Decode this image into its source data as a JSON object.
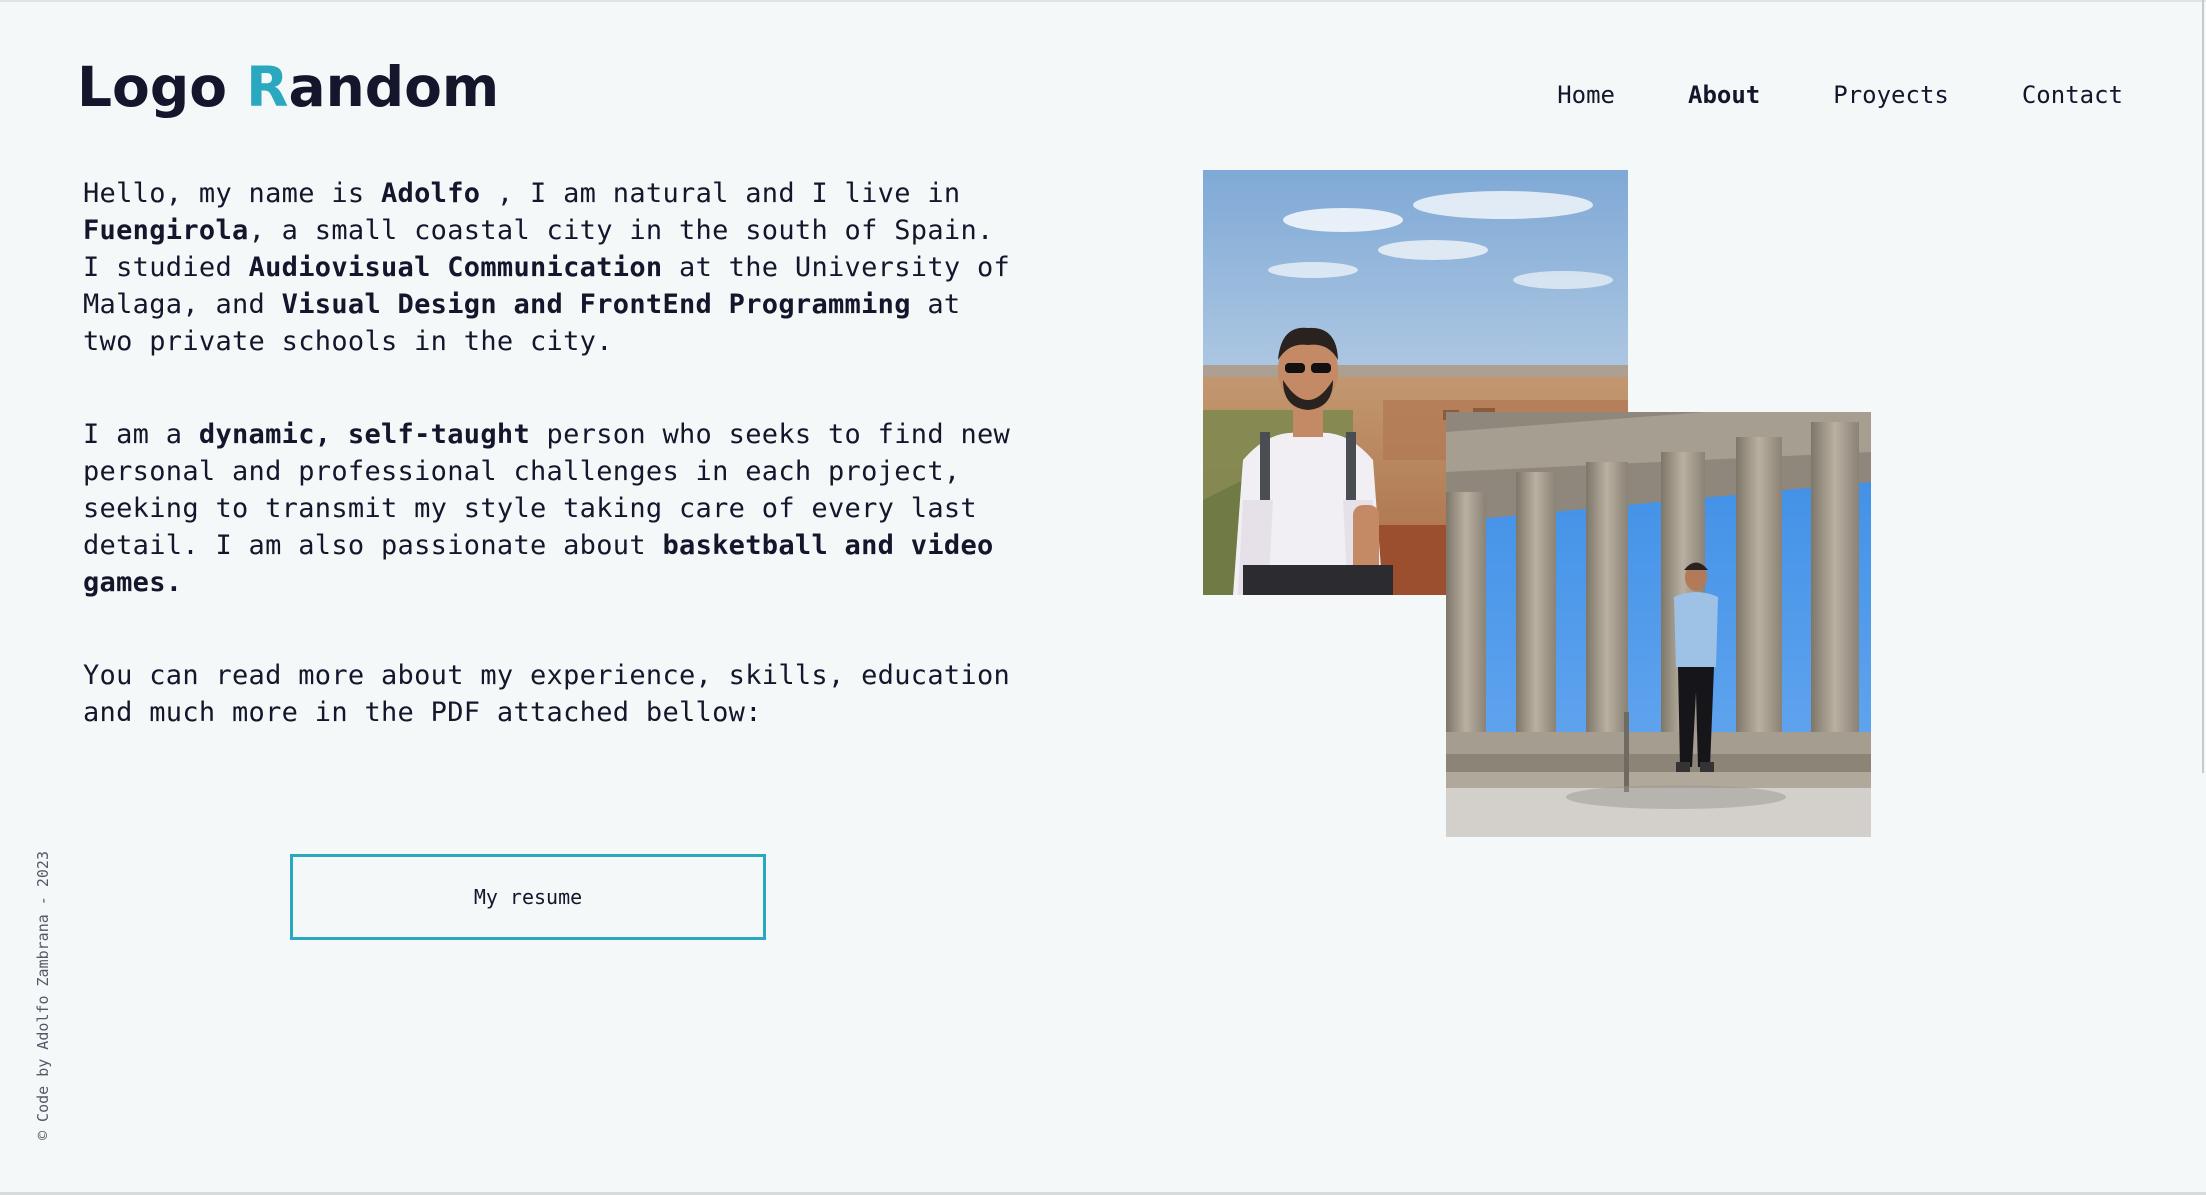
{
  "brand": {
    "logo_prefix": "Logo ",
    "logo_accent": "R",
    "logo_suffix": "andom",
    "accent_color": "#2aa8c0",
    "text_color": "#15152c",
    "background_color": "#f4f8f8"
  },
  "nav": {
    "items": [
      {
        "label": "Home",
        "active": false
      },
      {
        "label": "About",
        "active": true
      },
      {
        "label": "Proyects",
        "active": false
      },
      {
        "label": "Contact",
        "active": false
      }
    ]
  },
  "about": {
    "p1": {
      "t1": "Hello, my name is ",
      "b1": "Adolfo",
      "t2": " , I am natural and I live in ",
      "b2": "Fuengirola",
      "t3": ", a small coastal city in the south of Spain. I studied ",
      "b3": "Audiovisual Communication",
      "t4": " at the University of Malaga, and ",
      "b4": "Visual Design and FrontEnd Programming",
      "t5": " at two private schools in the city."
    },
    "p2": {
      "t1": "I am a ",
      "b1": "dynamic, self-taught",
      "t2": " person who seeks to find new personal and professional challenges in each project, seeking to transmit my style taking care of every last detail. I am also passionate about ",
      "b2": "basketball and video games."
    },
    "p3": {
      "t1": "You can read more about my experience, skills, education and much more in the PDF attached bellow:"
    },
    "resume_button": "My resume"
  },
  "footer": {
    "credit": "© Code by Adolfo Zambrana - 2023"
  },
  "photos": [
    {
      "subject": "man-in-desert-photo"
    },
    {
      "subject": "man-at-greek-temple-photo"
    }
  ]
}
